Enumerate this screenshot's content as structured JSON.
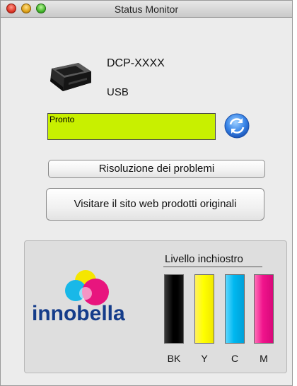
{
  "window": {
    "title": "Status Monitor"
  },
  "device": {
    "model": "DCP-XXXX",
    "connection": "USB",
    "status": "Pronto",
    "status_color": "#c8f000"
  },
  "buttons": {
    "troubleshoot": "Risoluzione dei problemi",
    "website": "Visitare il sito web prodotti originali"
  },
  "ink": {
    "title": "Livello inchiostro",
    "brand_logo": "innobella",
    "tanks": [
      {
        "label": "BK",
        "color": "#000000",
        "level": 1.0
      },
      {
        "label": "Y",
        "color": "#ffff00",
        "level": 1.0
      },
      {
        "label": "C",
        "color": "#00b8f0",
        "level": 1.0
      },
      {
        "label": "M",
        "color": "#f0148c",
        "level": 1.0
      }
    ]
  },
  "icons": [
    "printer-icon",
    "refresh-icon",
    "innobella-logo"
  ]
}
